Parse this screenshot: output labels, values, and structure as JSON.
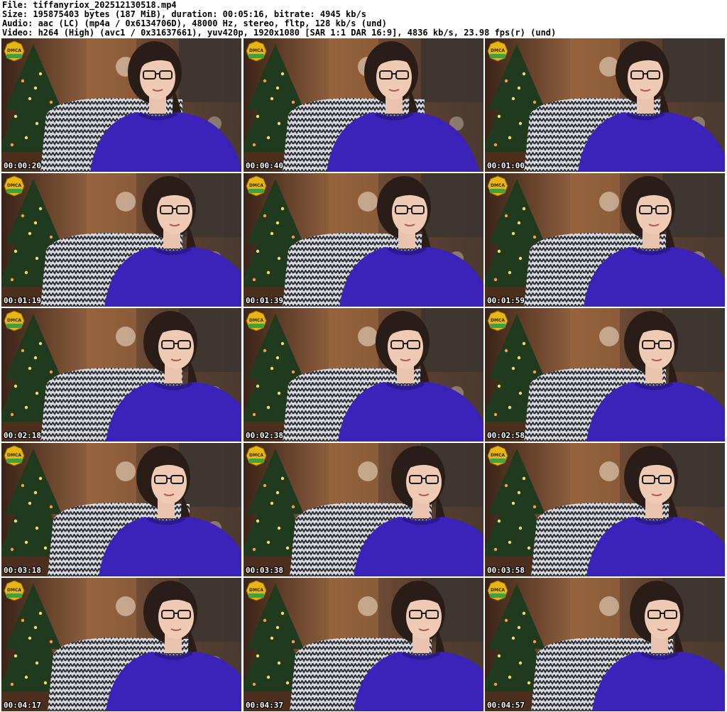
{
  "header": {
    "file_line": "File: tiffanyriox_202512130518.mp4",
    "size_line": "Size: 195875403 bytes (187 MiB), duration: 00:05:16, bitrate: 4945 kb/s",
    "audio_line": "Audio: aac (LC) (mp4a / 0x6134706D), 48000 Hz, stereo, fltp, 128 kb/s (und)",
    "video_line": "Video: h264 (High) (avc1 / 0x31637661), yuv420p, 1920x1080 [SAR 1:1 DAR 16:9], 4836 kb/s, 23.98 fps(r) (und)"
  },
  "badge_text": "DMCA",
  "colors": {
    "sweater": "#3b22b8",
    "background": "#ffffff",
    "chair_dark": "#2b2d33",
    "chair_light": "#d7d9de",
    "wall": "#6d4a35",
    "tree": "#1f3a1c",
    "badge": "#e8b614"
  },
  "thumbnails": [
    {
      "time": "00:00:20"
    },
    {
      "time": "00:00:40"
    },
    {
      "time": "00:01:00"
    },
    {
      "time": "00:01:19"
    },
    {
      "time": "00:01:39"
    },
    {
      "time": "00:01:59"
    },
    {
      "time": "00:02:18"
    },
    {
      "time": "00:02:38"
    },
    {
      "time": "00:02:58"
    },
    {
      "time": "00:03:18"
    },
    {
      "time": "00:03:38"
    },
    {
      "time": "00:03:58"
    },
    {
      "time": "00:04:17"
    },
    {
      "time": "00:04:37"
    },
    {
      "time": "00:04:57"
    }
  ]
}
